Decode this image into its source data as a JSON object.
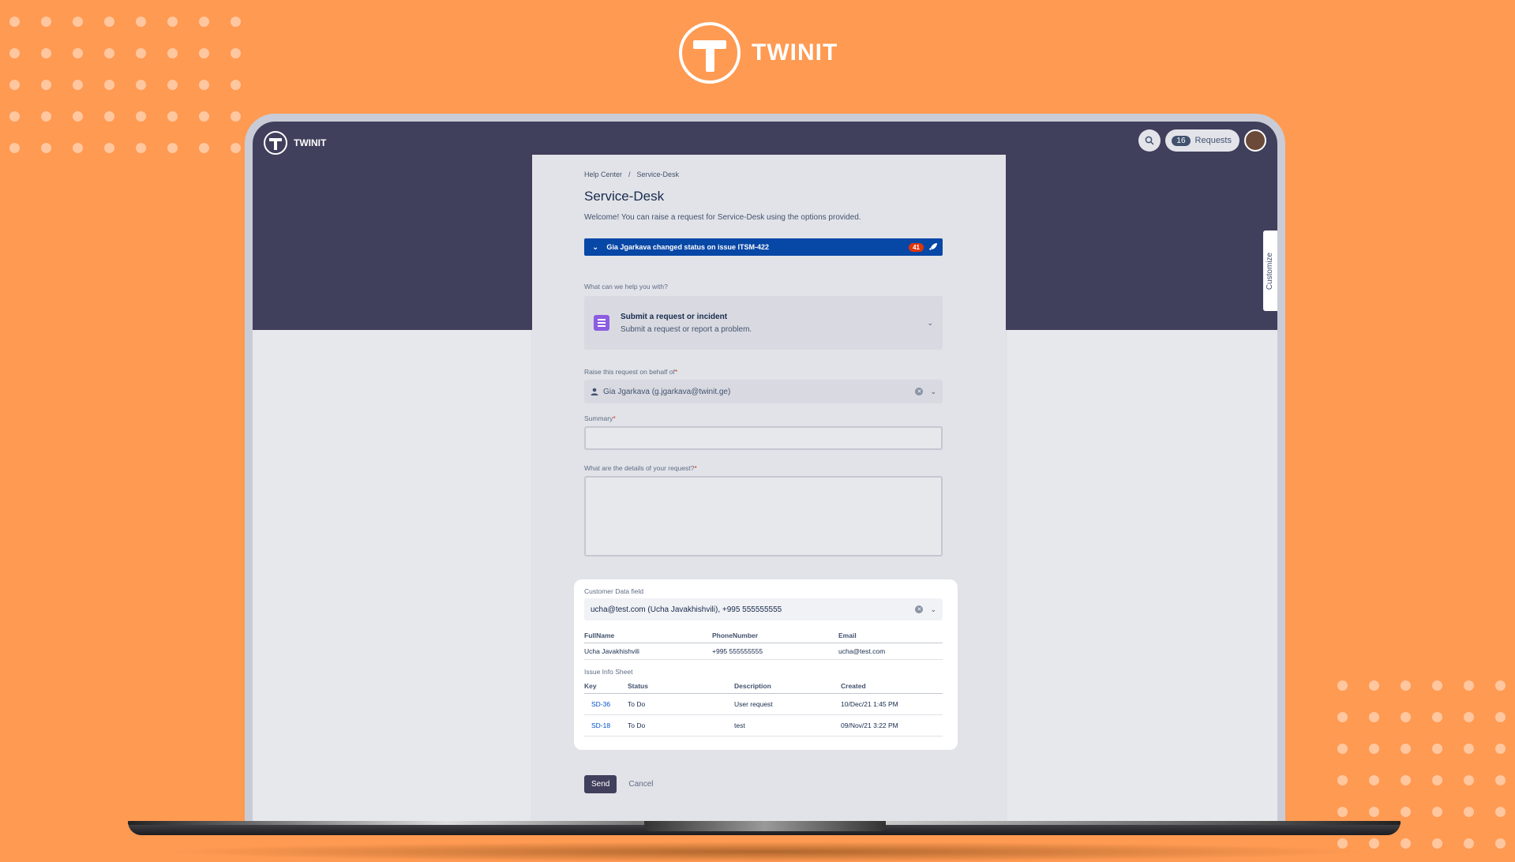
{
  "brand": {
    "name": "TWINIT"
  },
  "app": {
    "logo_text": "TWINIT",
    "requests_count": "16",
    "requests_label": "Requests",
    "customize_label": "Customize"
  },
  "portal": {
    "breadcrumb": [
      "Help Center",
      "/",
      "Service-Desk"
    ],
    "title": "Service-Desk",
    "welcome": "Welcome! You can raise a request for Service-Desk using the options provided.",
    "notification": {
      "text": "Gia Jgarkava changed status on issue ITSM-422",
      "count": "41"
    },
    "help_label": "What can we help you with?",
    "request_type": {
      "title": "Submit a request or incident",
      "subtitle": "Submit a request or report a problem."
    },
    "behalf_label": "Raise this request on behalf of",
    "behalf_value": "Gia Jgarkava (g.jgarkava@twinit.ge)",
    "summary_label": "Summary",
    "details_label": "What are the details of your request?",
    "required_mark": "*"
  },
  "customer": {
    "label": "Customer Data field",
    "value": "ucha@test.com (Ucha Javakhishvili), +995 555555555",
    "table": {
      "headers": [
        "FullName",
        "PhoneNumber",
        "Email"
      ],
      "rows": [
        [
          "Ucha Javakhishvili",
          "+995 555555555",
          "ucha@test.com"
        ]
      ]
    },
    "issue_sheet_label": "Issue Info Sheet",
    "issues": {
      "headers": [
        "Key",
        "Status",
        "Description",
        "Created"
      ],
      "rows": [
        [
          "SD-36",
          "To Do",
          "User request",
          "10/Dec/21 1:45 PM"
        ],
        [
          "SD-18",
          "To Do",
          "test",
          "09/Nov/21 3:22 PM"
        ]
      ]
    }
  },
  "actions": {
    "send": "Send",
    "cancel": "Cancel"
  },
  "colors": {
    "background": "#ff9a52",
    "header": "#403f5c",
    "notification": "#0747a6",
    "link": "#0052cc"
  }
}
